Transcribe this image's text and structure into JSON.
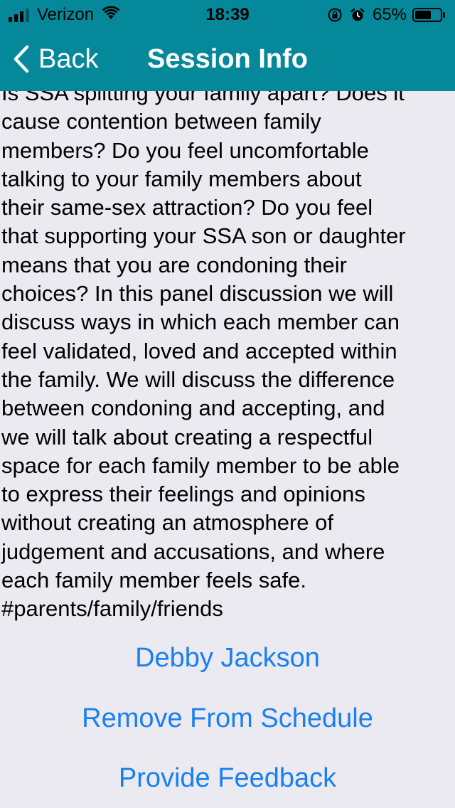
{
  "status_bar": {
    "carrier": "Verizon",
    "time": "18:39",
    "battery_percent": "65%",
    "battery_level": 0.65,
    "icons": [
      "signal-icon",
      "wifi-icon",
      "orientation-lock-icon",
      "alarm-icon",
      "battery-icon"
    ]
  },
  "nav": {
    "back_label": "Back",
    "title": "Session Info"
  },
  "session": {
    "description": "Is SSA splitting your family apart?  Does it\ncause contention between family\nmembers?  Do you feel uncomfortable\ntalking to your family members about\ntheir same-sex attraction?  Do you feel\nthat supporting your SSA son or daughter\nmeans that you are condoning their\nchoices?  In this panel discussion we will\ndiscuss ways in which each member can\nfeel validated, loved and accepted within\nthe family.  We will discuss the difference\nbetween condoning and accepting, and\nwe will talk about creating a respectful\nspace for each family member to be able\nto express their feelings and opinions\nwithout creating an atmosphere of\njudgement and accusations, and where\neach family member feels safe.\n#parents/family/friends"
  },
  "actions": {
    "speaker": "Debby Jackson",
    "remove": "Remove From Schedule",
    "feedback": "Provide Feedback"
  },
  "colors": {
    "header_bg": "#04889a",
    "page_bg": "#ebeaf0",
    "link": "#1a7ff0"
  }
}
